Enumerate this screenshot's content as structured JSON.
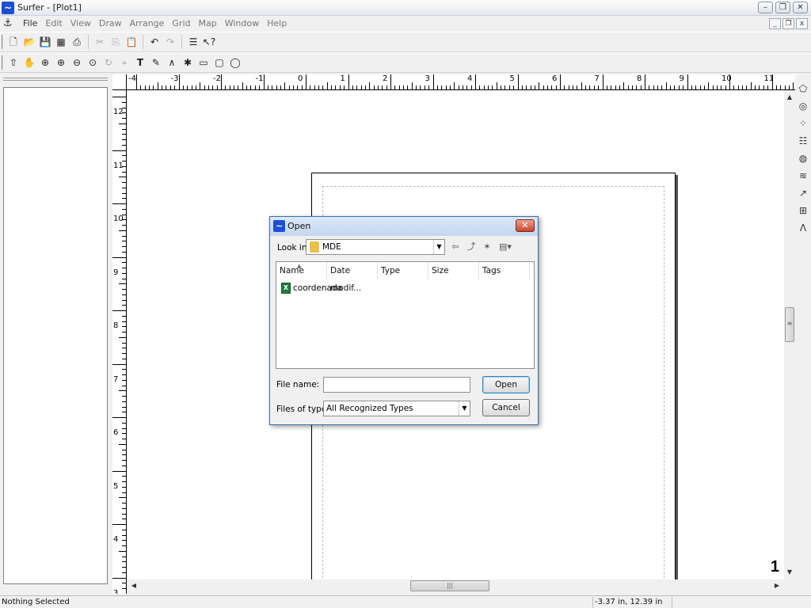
{
  "window": {
    "title": "Surfer - [Plot1]",
    "min": "–",
    "max": "❐",
    "close": "✕"
  },
  "menubar": {
    "items": [
      "File",
      "Edit",
      "View",
      "Draw",
      "Arrange",
      "Grid",
      "Map",
      "Window",
      "Help"
    ],
    "mdi_min": "_",
    "mdi_restore": "❐",
    "mdi_close": "x"
  },
  "hruler": {
    "labels": [
      "-4",
      "-3",
      "-2",
      "-1",
      "0",
      "1",
      "2",
      "3",
      "4",
      "5",
      "6",
      "7",
      "8",
      "9",
      "10",
      "11"
    ]
  },
  "vruler": {
    "labels": [
      "12",
      "11",
      "10",
      "9",
      "8",
      "7",
      "6",
      "5",
      "4",
      "3"
    ]
  },
  "canvas": {
    "page_number": "1"
  },
  "statusbar": {
    "selection": "Nothing Selected",
    "coordinates": "-3.37 in, 12.39 in"
  },
  "dialog": {
    "title": "Open",
    "close": "✕",
    "look_in_label": "Look in:",
    "look_in_value": "MDE",
    "columns": [
      "Name",
      "Date modif...",
      "Type",
      "Size",
      "Tags"
    ],
    "files": [
      {
        "name": "coordenada",
        "icon": "excel-file-icon"
      }
    ],
    "file_name_label": "File name:",
    "file_name_value": "",
    "files_of_type_label": "Files of type:",
    "files_of_type_value": "All Recognized Types",
    "open_button": "Open",
    "cancel_button": "Cancel"
  }
}
